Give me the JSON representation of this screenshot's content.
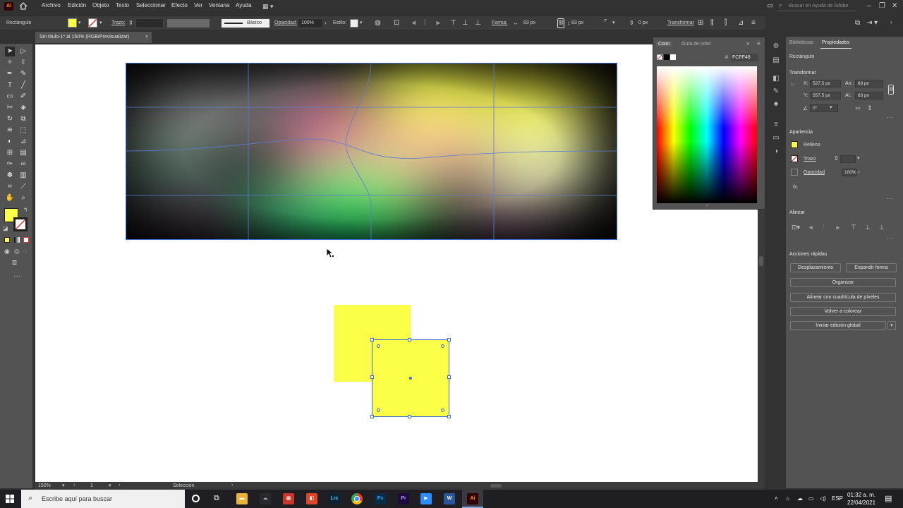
{
  "app": {
    "logo": "Ai"
  },
  "menu": [
    "Archivo",
    "Edición",
    "Objeto",
    "Texto",
    "Seleccionar",
    "Efecto",
    "Ver",
    "Ventana",
    "Ayuda"
  ],
  "search": {
    "placeholder": "Buscar en Ayuda de Adobe"
  },
  "controlbar": {
    "object_type": "Rectángulo",
    "stroke_label": "Trazo:",
    "brush_label": "Básico",
    "opacity_label": "Opacidad:",
    "opacity_value": "100%",
    "style_label": "Estilo:",
    "shape_label": "Forma:",
    "width_value": "83 px",
    "height_value": "83 px",
    "corner_value": "0 px",
    "transform_label": "Transformar"
  },
  "document": {
    "tab_title": "Sin título-1* al 150% (RGB/Previsualizar)"
  },
  "color_panel": {
    "tab_color": "Color",
    "tab_guide": "Guía de color",
    "hex_value": "FCFF48",
    "hex_symbol": "#"
  },
  "properties": {
    "tab_libraries": "Bibliotecas",
    "tab_properties": "Propiedades",
    "object_type": "Rectángulo",
    "transform_heading": "Transformar",
    "x_label": "X:",
    "x_value": "527,5 px",
    "y_label": "Y:",
    "y_value": "557,5 px",
    "w_label": "An.:",
    "w_value": "83 px",
    "h_label": "Al.:",
    "h_value": "83 px",
    "angle_value": "0°",
    "appearance_heading": "Apariencia",
    "fill_label": "Relleno",
    "stroke_label": "Trazo",
    "opacity_label": "Opacidad",
    "opacity_value": "100%",
    "fx_label": "fx.",
    "align_heading": "Alinear",
    "quick_actions_heading": "Acciones rápidas",
    "btn_offset": "Desplazamiento",
    "btn_expand": "Expandir forma",
    "btn_arrange": "Organizar",
    "btn_pixel_grid": "Alinear con cuadrícula de píxeles",
    "btn_recolor": "Volver a colorear",
    "btn_global_edit": "Iniciar edición global"
  },
  "statusbar": {
    "zoom": "150%",
    "artboard_index": "1",
    "tool_name": "Selección"
  },
  "taskbar": {
    "search_placeholder": "Escribe aquí para buscar",
    "language": "ESP",
    "time": "01:32 a. m.",
    "date": "22/04/2021",
    "apps": [
      "Lrc",
      "Ps",
      "Pr",
      "W",
      "Ai"
    ]
  },
  "colors": {
    "fill": "#FCFF48",
    "selection": "#3f6bd6",
    "ui_bg": "#535353"
  },
  "icons": [
    "home-icon",
    "search-icon",
    "selection-tool-icon",
    "direct-selection-icon",
    "pen-icon",
    "type-icon",
    "hand-icon",
    "zoom-icon",
    "windows-icon",
    "chrome-icon"
  ]
}
